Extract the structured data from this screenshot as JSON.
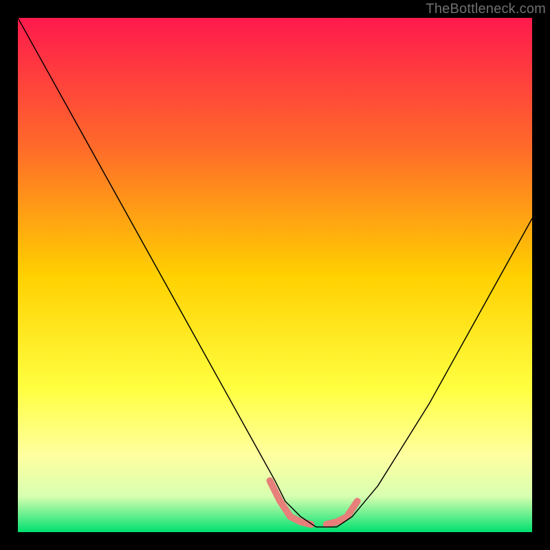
{
  "watermark": "TheBottleneck.com",
  "chart_data": {
    "type": "line",
    "title": "",
    "xlabel": "",
    "ylabel": "",
    "xlim": [
      0,
      100
    ],
    "ylim": [
      0,
      100
    ],
    "background_gradient": {
      "stops": [
        {
          "offset": 0,
          "color": "#ff1a4d"
        },
        {
          "offset": 25,
          "color": "#ff6a2a"
        },
        {
          "offset": 50,
          "color": "#ffd000"
        },
        {
          "offset": 72,
          "color": "#ffff40"
        },
        {
          "offset": 85,
          "color": "#ffffa0"
        },
        {
          "offset": 93,
          "color": "#d8ffb0"
        },
        {
          "offset": 100,
          "color": "#00e070"
        }
      ]
    },
    "series": [
      {
        "name": "bottleneck-curve",
        "color": "#000000",
        "width": 1.5,
        "x": [
          0,
          5,
          10,
          15,
          20,
          25,
          30,
          35,
          40,
          45,
          50,
          52,
          55,
          58,
          60,
          62,
          65,
          70,
          75,
          80,
          85,
          90,
          95,
          100
        ],
        "y": [
          100,
          91,
          82,
          73,
          64,
          55,
          46,
          37,
          28,
          19,
          10,
          6,
          3,
          1,
          1,
          1,
          3,
          9,
          17,
          25,
          34,
          43,
          52,
          61
        ]
      }
    ],
    "markers": [
      {
        "name": "recommended-range-left",
        "color": "#e77f7a",
        "width": 10,
        "x": [
          49,
          51,
          53,
          55,
          57
        ],
        "y": [
          10,
          6,
          3,
          2,
          1.5
        ]
      },
      {
        "name": "recommended-range-right",
        "color": "#e77f7a",
        "width": 10,
        "x": [
          60,
          62,
          64,
          66
        ],
        "y": [
          1.5,
          2,
          3,
          6
        ]
      }
    ],
    "annotations": []
  }
}
